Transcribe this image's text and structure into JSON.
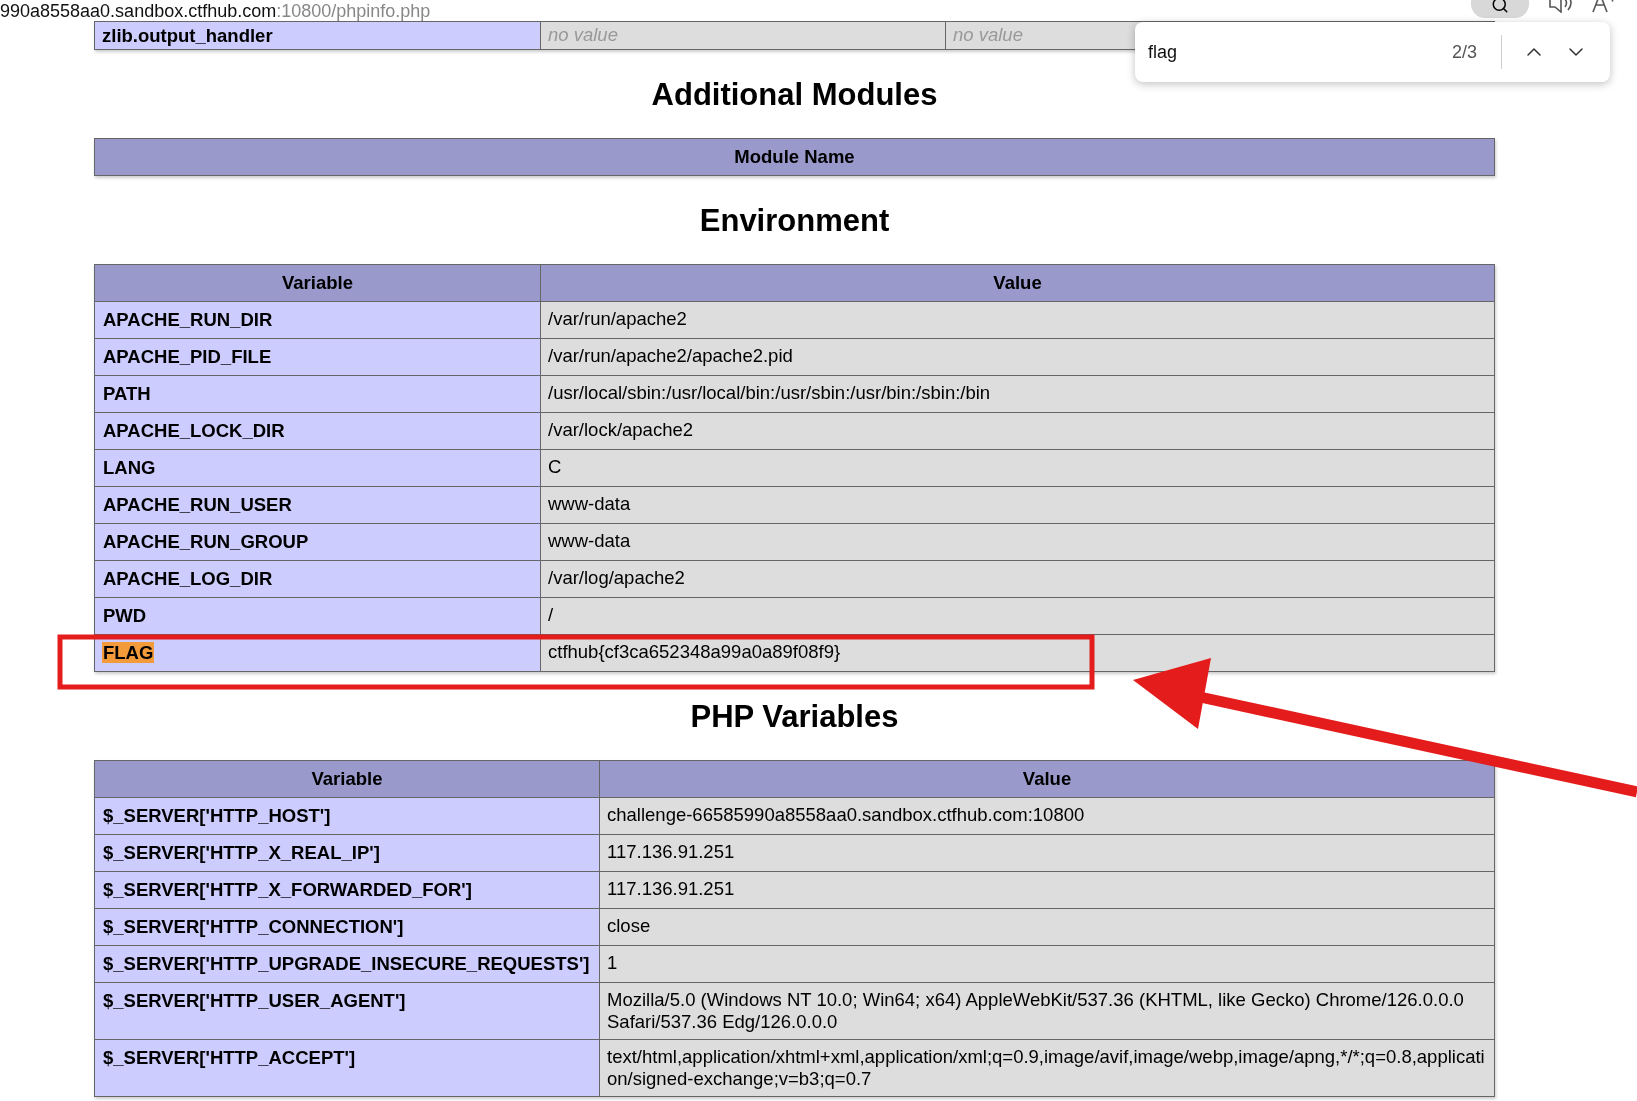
{
  "browser": {
    "url_host": "990a8558aa0.sandbox.ctfhub.com",
    "url_path": ":10800/phpinfo.php"
  },
  "find_bar": {
    "query": "flag",
    "count": "2/3"
  },
  "top_row": {
    "cells": [
      "zlib.output_handler",
      "no value",
      "no value"
    ]
  },
  "sections": [
    {
      "title": "Additional Modules",
      "columns": [
        "Module Name"
      ]
    },
    {
      "title": "Environment",
      "columns": [
        "Variable",
        "Value"
      ],
      "rows": [
        {
          "cells": [
            "APACHE_RUN_DIR",
            "/var/run/apache2"
          ],
          "match": false
        },
        {
          "cells": [
            "APACHE_PID_FILE",
            "/var/run/apache2/apache2.pid"
          ],
          "match": false
        },
        {
          "cells": [
            "PATH",
            "/usr/local/sbin:/usr/local/bin:/usr/sbin:/usr/bin:/sbin:/bin"
          ],
          "match": false
        },
        {
          "cells": [
            "APACHE_LOCK_DIR",
            "/var/lock/apache2"
          ],
          "match": false
        },
        {
          "cells": [
            "LANG",
            "C"
          ],
          "match": false
        },
        {
          "cells": [
            "APACHE_RUN_USER",
            "www-data"
          ],
          "match": false
        },
        {
          "cells": [
            "APACHE_RUN_GROUP",
            "www-data"
          ],
          "match": false
        },
        {
          "cells": [
            "APACHE_LOG_DIR",
            "/var/log/apache2"
          ],
          "match": false
        },
        {
          "cells": [
            "PWD",
            "/"
          ],
          "match": false
        },
        {
          "cells": [
            "FLAG",
            "ctfhub{cf3ca652348a99a0a89f08f9}"
          ],
          "match": true
        }
      ]
    },
    {
      "title": "PHP Variables",
      "columns": [
        "Variable",
        "Value"
      ],
      "rows": [
        {
          "cells": [
            "$_SERVER['HTTP_HOST']",
            "challenge-66585990a8558aa0.sandbox.ctfhub.com:10800"
          ],
          "match": false
        },
        {
          "cells": [
            "$_SERVER['HTTP_X_REAL_IP']",
            "117.136.91.251"
          ],
          "match": false
        },
        {
          "cells": [
            "$_SERVER['HTTP_X_FORWARDED_FOR']",
            "117.136.91.251"
          ],
          "match": false
        },
        {
          "cells": [
            "$_SERVER['HTTP_CONNECTION']",
            "close"
          ],
          "match": false
        },
        {
          "cells": [
            "$_SERVER['HTTP_UPGRADE_INSECURE_REQUESTS']",
            "1"
          ],
          "match": false
        },
        {
          "cells": [
            "$_SERVER['HTTP_USER_AGENT']",
            "Mozilla/5.0 (Windows NT 10.0; Win64; x64) AppleWebKit/537.36 (KHTML, like Gecko) Chrome/126.0.0.0 Safari/537.36 Edg/126.0.0.0"
          ],
          "match": false
        },
        {
          "cells": [
            "$_SERVER['HTTP_ACCEPT']",
            "text/html,application/xhtml+xml,application/xml;q=0.9,image/avif,image/webp,image/apng,*/*;q=0.8,application/signed-exchange;v=b3;q=0.7"
          ],
          "match": false
        }
      ]
    }
  ]
}
